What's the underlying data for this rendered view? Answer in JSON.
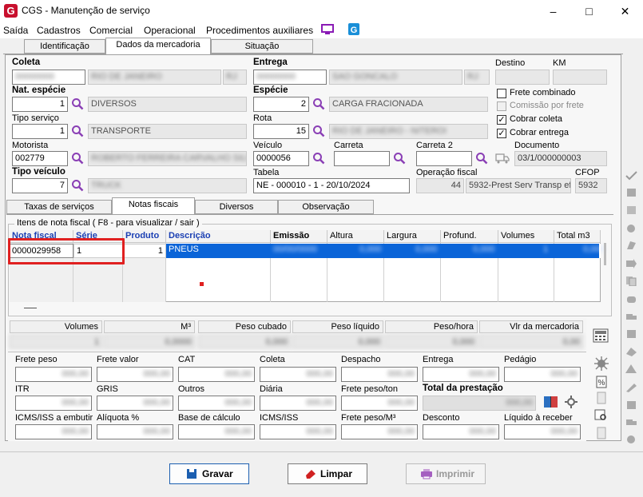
{
  "window": {
    "app_icon": "G",
    "title": "CGS - Manutenção de serviço",
    "min": "–",
    "max": "□",
    "close": "✕"
  },
  "menu": [
    "Saída",
    "Cadastros",
    "Comercial",
    "Operacional",
    "Procedimentos auxiliares"
  ],
  "top_tabs": [
    "Identificação",
    "Dados da mercadoria",
    "Situação"
  ],
  "header": {
    "coleta_label": "Coleta",
    "entrega_label": "Entrega",
    "destino_label": "Destino",
    "km_label": "KM",
    "coleta_code": "00000000",
    "coleta_city": "RIO DE JANEIRO",
    "coleta_uf": "RJ",
    "entrega_code": "00000000",
    "entrega_city": "SAO GONCALO",
    "entrega_uf": "RJ",
    "nat_especie_label": "Nat. espécie",
    "nat_especie_value": "1",
    "nat_especie_desc": "DIVERSOS",
    "especie_label": "Espécie",
    "especie_value": "2",
    "especie_desc": "CARGA FRACIONADA",
    "tipo_servico_label": "Tipo serviço",
    "tipo_servico_value": "1",
    "tipo_servico_desc": "TRANSPORTE",
    "rota_label": "Rota",
    "rota_value": "15",
    "rota_desc": "RIO DE JANEIRO - NITEROI",
    "motorista_label": "Motorista",
    "motorista_value": "002779",
    "motorista_name": "ROBERTO FERREIRA CARVALHO SILVA",
    "veiculo_label": "Veículo",
    "veiculo_value": "0000056",
    "carreta_label": "Carreta",
    "carreta2_label": "Carreta 2",
    "documento_label": "Documento",
    "documento_value": "03/1/000000003",
    "tipo_veiculo_label": "Tipo veículo",
    "tipo_veiculo_value": "7",
    "tipo_veiculo_desc": "TRUCK",
    "tabela_label": "Tabela",
    "tabela_value": "NE - 000010 - 1 - 20/10/2024",
    "operacao_label": "Operação fiscal",
    "operacao_value": "44",
    "operacao_desc": "5932-Prest Serv Transp efe",
    "cfop_label": "CFOP",
    "cfop_value": "5932",
    "frete_combinado": "Frete combinado",
    "comissao_por_frete": "Comissão por frete",
    "cobrar_coleta": "Cobrar coleta",
    "cobrar_entrega": "Cobrar entrega",
    "check_mark": "✓"
  },
  "inner_tabs": [
    "Taxas de serviços",
    "Notas fiscais",
    "Diversos",
    "Observação"
  ],
  "itens_group_title": "Itens de nota fiscal ( F8 - para visualizar / sair )",
  "grid": {
    "columns": [
      "Nota fiscal",
      "Série",
      "Produto",
      "Descrição",
      "Emissão",
      "Altura",
      "Largura",
      "Profund.",
      "Volumes",
      "Total m3"
    ],
    "row": [
      "0000029958",
      "1",
      "1",
      "PNEUS",
      "00/00/0000",
      "0,000",
      "0,000",
      "0,000",
      "1",
      "0,000"
    ]
  },
  "summary": {
    "headers": [
      "Volumes",
      "M³",
      "Peso cubado",
      "Peso líquido",
      "Peso/hora",
      "Vlr da mercadoria"
    ],
    "values": [
      "1",
      "0,0000",
      "0,000",
      "0,000",
      "0,000",
      "0,00"
    ]
  },
  "freight": {
    "row1": [
      "Frete peso",
      "Frete valor",
      "CAT",
      "Coleta",
      "Despacho",
      "Entrega",
      "Pedágio"
    ],
    "row2": [
      "ITR",
      "GRIS",
      "Outros",
      "Diária",
      "Frete peso/ton",
      "Total da prestação"
    ],
    "row3": [
      "ICMS/ISS a embutir",
      "Alíquota %",
      "Base de cálculo",
      "ICMS/ISS",
      "Frete peso/M³",
      "Desconto",
      "Líquido à receber"
    ],
    "placeholder": "000,00"
  },
  "buttons": {
    "gravar": "Gravar",
    "limpar": "Limpar",
    "imprimir": "Imprimir"
  },
  "colors": {
    "accent_red": "#c8102e",
    "selection_blue": "#0a64d8",
    "highlight_red": "#e02020",
    "header_blue": "#1a3fb3"
  }
}
